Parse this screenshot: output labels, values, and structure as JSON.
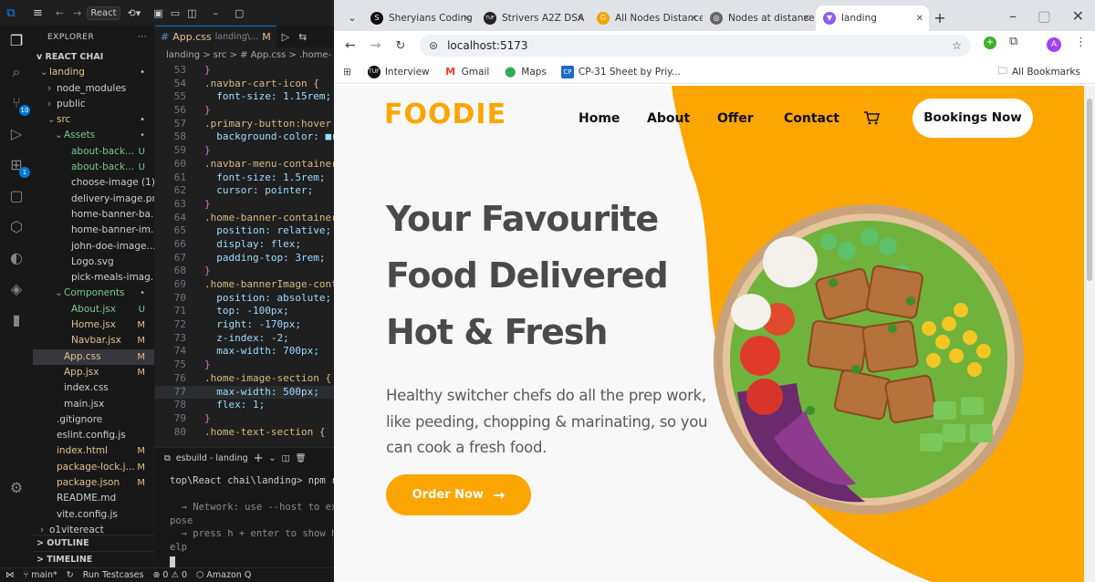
{
  "vscode": {
    "search": "React",
    "explorer_title": "EXPLORER",
    "project": "REACT CHAI",
    "tree": [
      {
        "label": "landing",
        "indent": 1,
        "arrow": "v",
        "status": "•",
        "cls": "mod"
      },
      {
        "label": "node_modules",
        "indent": 2,
        "arrow": ">",
        "status": "",
        "cls": ""
      },
      {
        "label": "public",
        "indent": 2,
        "arrow": ">",
        "status": "",
        "cls": ""
      },
      {
        "label": "src",
        "indent": 2,
        "arrow": "v",
        "status": "•",
        "cls": "mod"
      },
      {
        "label": "Assets",
        "indent": 3,
        "arrow": "v",
        "status": "•",
        "cls": "unt"
      },
      {
        "label": "about-back...",
        "indent": 4,
        "arrow": "",
        "status": "U",
        "cls": "unt"
      },
      {
        "label": "about-back...",
        "indent": 4,
        "arrow": "",
        "status": "U",
        "cls": "unt"
      },
      {
        "label": "choose-image (1)...",
        "indent": 4,
        "arrow": "",
        "status": "",
        "cls": ""
      },
      {
        "label": "delivery-image.png",
        "indent": 4,
        "arrow": "",
        "status": "",
        "cls": ""
      },
      {
        "label": "home-banner-ba...",
        "indent": 4,
        "arrow": "",
        "status": "",
        "cls": ""
      },
      {
        "label": "home-banner-im...",
        "indent": 4,
        "arrow": "",
        "status": "",
        "cls": ""
      },
      {
        "label": "john-doe-image....",
        "indent": 4,
        "arrow": "",
        "status": "",
        "cls": ""
      },
      {
        "label": "Logo.svg",
        "indent": 4,
        "arrow": "",
        "status": "",
        "cls": ""
      },
      {
        "label": "pick-meals-imag...",
        "indent": 4,
        "arrow": "",
        "status": "",
        "cls": ""
      },
      {
        "label": "Components",
        "indent": 3,
        "arrow": "v",
        "status": "•",
        "cls": "unt"
      },
      {
        "label": "About.jsx",
        "indent": 4,
        "arrow": "",
        "status": "U",
        "cls": "unt"
      },
      {
        "label": "Home.jsx",
        "indent": 4,
        "arrow": "",
        "status": "M",
        "cls": "mod"
      },
      {
        "label": "Navbar.jsx",
        "indent": 4,
        "arrow": "",
        "status": "M",
        "cls": "mod"
      },
      {
        "label": "App.css",
        "indent": 3,
        "arrow": "",
        "status": "M",
        "cls": "mod",
        "sel": true
      },
      {
        "label": "App.jsx",
        "indent": 3,
        "arrow": "",
        "status": "M",
        "cls": "mod"
      },
      {
        "label": "index.css",
        "indent": 3,
        "arrow": "",
        "status": "",
        "cls": ""
      },
      {
        "label": "main.jsx",
        "indent": 3,
        "arrow": "",
        "status": "",
        "cls": ""
      },
      {
        "label": ".gitignore",
        "indent": 2,
        "arrow": "",
        "status": "",
        "cls": ""
      },
      {
        "label": "eslint.config.js",
        "indent": 2,
        "arrow": "",
        "status": "",
        "cls": ""
      },
      {
        "label": "index.html",
        "indent": 2,
        "arrow": "",
        "status": "M",
        "cls": "mod"
      },
      {
        "label": "package-lock.j...",
        "indent": 2,
        "arrow": "",
        "status": "M",
        "cls": "mod"
      },
      {
        "label": "package.json",
        "indent": 2,
        "arrow": "",
        "status": "M",
        "cls": "mod"
      },
      {
        "label": "README.md",
        "indent": 2,
        "arrow": "",
        "status": "",
        "cls": ""
      },
      {
        "label": "vite.config.js",
        "indent": 2,
        "arrow": "",
        "status": "",
        "cls": ""
      },
      {
        "label": "o1vitereact",
        "indent": 1,
        "arrow": ">",
        "status": "",
        "cls": ""
      }
    ],
    "outline": "OUTLINE",
    "timeline": "TIMELINE",
    "tab_label": "App.css",
    "tab_path": "landing\\...",
    "tab_status": "M",
    "breadcrumbs": "landing > src > # App.css > .home-",
    "code": [
      {
        "n": "53",
        "t": "}"
      },
      {
        "n": "54",
        "t": ".navbar-cart-icon {"
      },
      {
        "n": "55",
        "t": "  font-size: 1.15rem;"
      },
      {
        "n": "56",
        "t": "}"
      },
      {
        "n": "57",
        "t": ".primary-button:hover {"
      },
      {
        "n": "58",
        "t": "  background-color: ■rg"
      },
      {
        "n": "59",
        "t": "}"
      },
      {
        "n": "60",
        "t": ".navbar-menu-container {"
      },
      {
        "n": "61",
        "t": "  font-size: 1.5rem;"
      },
      {
        "n": "62",
        "t": "  cursor: pointer;"
      },
      {
        "n": "63",
        "t": "}"
      },
      {
        "n": "64",
        "t": ".home-banner-container {"
      },
      {
        "n": "65",
        "t": "  position: relative;"
      },
      {
        "n": "66",
        "t": "  display: flex;"
      },
      {
        "n": "67",
        "t": "  padding-top: 3rem;"
      },
      {
        "n": "68",
        "t": "}"
      },
      {
        "n": "69",
        "t": ".home-bannerImage-conta"
      },
      {
        "n": "70",
        "t": "  position: absolute;"
      },
      {
        "n": "71",
        "t": "  top: -100px;"
      },
      {
        "n": "72",
        "t": "  right: -170px;"
      },
      {
        "n": "73",
        "t": "  z-index: -2;"
      },
      {
        "n": "74",
        "t": "  max-width: 700px;"
      },
      {
        "n": "75",
        "t": "}"
      },
      {
        "n": "76",
        "t": ".home-image-section {"
      },
      {
        "n": "77",
        "t": "  max-width: 500px;"
      },
      {
        "n": "78",
        "t": "  flex: 1;"
      },
      {
        "n": "79",
        "t": "}"
      },
      {
        "n": "80",
        "t": ".home-text-section {"
      }
    ],
    "terminal_tab": "esbuild - landing",
    "terminal_lines": [
      "top\\React chai\\landing> npm ru",
      "",
      "  → Network: use --host to ex",
      "pose",
      "  → press h + enter to show h",
      "elp"
    ],
    "status": {
      "branch": "main*",
      "testcases": "Run Testcases",
      "errors": "0",
      "warnings": "0",
      "amazon": "Amazon Q"
    }
  },
  "chrome": {
    "tabs": [
      {
        "label": "Sheryians Coding",
        "color": "#111",
        "glyph": "S"
      },
      {
        "label": "Strivers A2Z DSA",
        "color": "#222",
        "glyph": "TUF"
      },
      {
        "label": "All Nodes Distance",
        "color": "#f4a300",
        "glyph": "G"
      },
      {
        "label": "Nodes at distance",
        "color": "#666",
        "glyph": "◎"
      },
      {
        "label": "landing",
        "color": "#8b5cf6",
        "glyph": "▼",
        "active": true
      }
    ],
    "url": "localhost:5173",
    "avatar": "A",
    "bookmarks": [
      "Interview",
      "Gmail",
      "Maps",
      "CP-31 Sheet by Priy..."
    ],
    "all_bookmarks": "All Bookmarks"
  },
  "site": {
    "logo": "FOODIE",
    "nav": [
      "Home",
      "About",
      "Offer",
      "Contact"
    ],
    "booking_button": "Bookings Now",
    "headline": [
      "Your Favourite",
      "Food Delivered",
      "Hot & Fresh"
    ],
    "subtext": [
      "Healthy switcher chefs do all the prep work,",
      "like peeding, chopping & marinating, so you",
      "can cook a fresh food."
    ],
    "order_button": "Order Now",
    "accent": "#fda500"
  }
}
